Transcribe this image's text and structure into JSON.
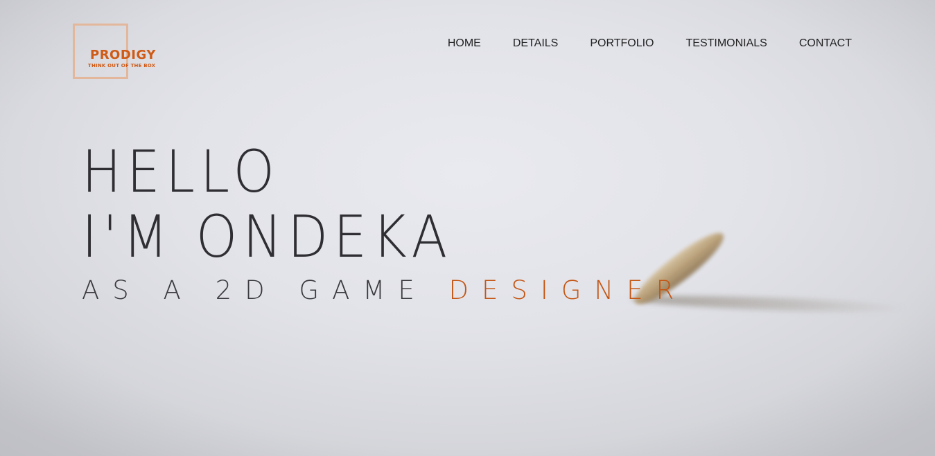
{
  "logo": {
    "name": "PRODIGY",
    "tagline": "THINK OUT OF THE BOX"
  },
  "nav": {
    "items": [
      {
        "label": "HOME"
      },
      {
        "label": "DETAILS"
      },
      {
        "label": "PORTFOLIO"
      },
      {
        "label": "TESTIMONIALS"
      },
      {
        "label": "CONTACT"
      }
    ]
  },
  "hero": {
    "line1": "HELLO",
    "line2": "I'M ONDEKA",
    "subtitle_prefix": "AS A 2D GAME",
    "subtitle_accent": "DESIGNER"
  },
  "colors": {
    "accent": "#c45614",
    "logo_box": "#e3b79c",
    "text": "#2f2f33"
  }
}
